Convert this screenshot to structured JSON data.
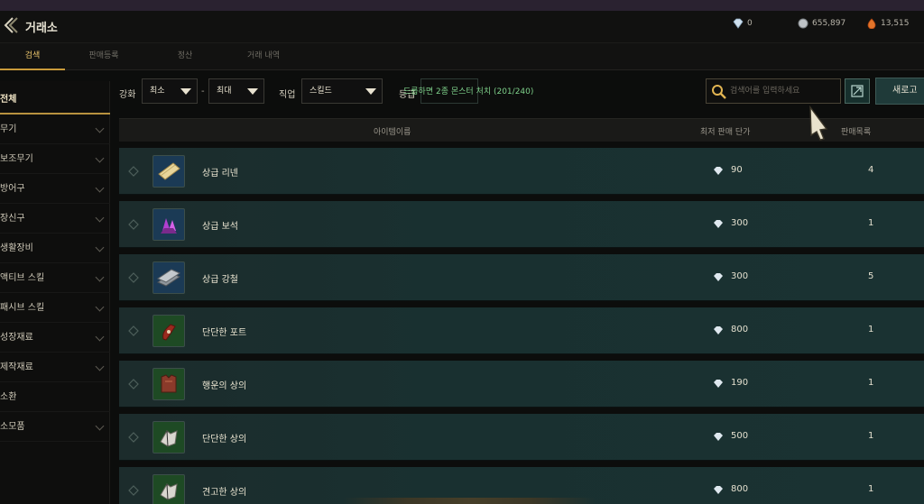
{
  "window": {
    "title": "거래소"
  },
  "currencies": [
    {
      "icon": "crystal-icon",
      "value": "0"
    },
    {
      "icon": "silver-coin-icon",
      "value": "655,897"
    },
    {
      "icon": "red-gem-icon",
      "value": "13,515"
    }
  ],
  "tabs": [
    {
      "label": "검색",
      "active": true
    },
    {
      "label": "판매등록",
      "active": false
    },
    {
      "label": "정산",
      "active": false
    },
    {
      "label": "거래 내역",
      "active": false
    }
  ],
  "sidebar": {
    "items": [
      {
        "label": "전체",
        "active": true,
        "expandable": false
      },
      {
        "label": "무기",
        "expandable": true
      },
      {
        "label": "보조무기",
        "expandable": true
      },
      {
        "label": "방어구",
        "expandable": true
      },
      {
        "label": "장신구",
        "expandable": true
      },
      {
        "label": "생활장비",
        "expandable": true
      },
      {
        "label": "액티브 스킬",
        "expandable": true
      },
      {
        "label": "패시브 스킬",
        "expandable": true
      },
      {
        "label": "성장재료",
        "expandable": true
      },
      {
        "label": "제작재료",
        "expandable": true
      },
      {
        "label": "소환",
        "expandable": false
      },
      {
        "label": "소모품",
        "expandable": true
      }
    ]
  },
  "filters": {
    "enhance_label": "강화",
    "enhance_min": "최소",
    "enhance_sep": "-",
    "enhance_max": "최대",
    "class_label": "직업",
    "class_value": "스킬드",
    "grade_label": "등급",
    "quest_tip": "드롭하면 2종 몬스터 처치 (201/240)"
  },
  "search": {
    "placeholder": "검색어를 입력하세요",
    "value": ""
  },
  "refresh_label": "새로고",
  "table": {
    "headers": {
      "name": "아이템이름",
      "price": "최저 판매 단가",
      "count": "판매목록"
    },
    "rows": [
      {
        "name": "상급 리넨",
        "price": "90",
        "count": "4",
        "icon": "linen-icon"
      },
      {
        "name": "상급 보석",
        "price": "300",
        "count": "1",
        "icon": "gem-crystal-icon"
      },
      {
        "name": "상급 강철",
        "price": "300",
        "count": "5",
        "icon": "steel-ingot-icon"
      },
      {
        "name": "단단한 포트",
        "price": "800",
        "count": "1",
        "icon": "potion-icon"
      },
      {
        "name": "행운의 상의",
        "price": "190",
        "count": "1",
        "icon": "armor-red-icon"
      },
      {
        "name": "단단한 상의",
        "price": "500",
        "count": "1",
        "icon": "armor-white-icon"
      },
      {
        "name": "견고한 상의",
        "price": "800",
        "count": "1",
        "icon": "armor-white-icon"
      }
    ]
  },
  "colors": {
    "accent": "#c89a3a",
    "row_bg": "#1a3232",
    "quest_green": "#7ed08a"
  }
}
